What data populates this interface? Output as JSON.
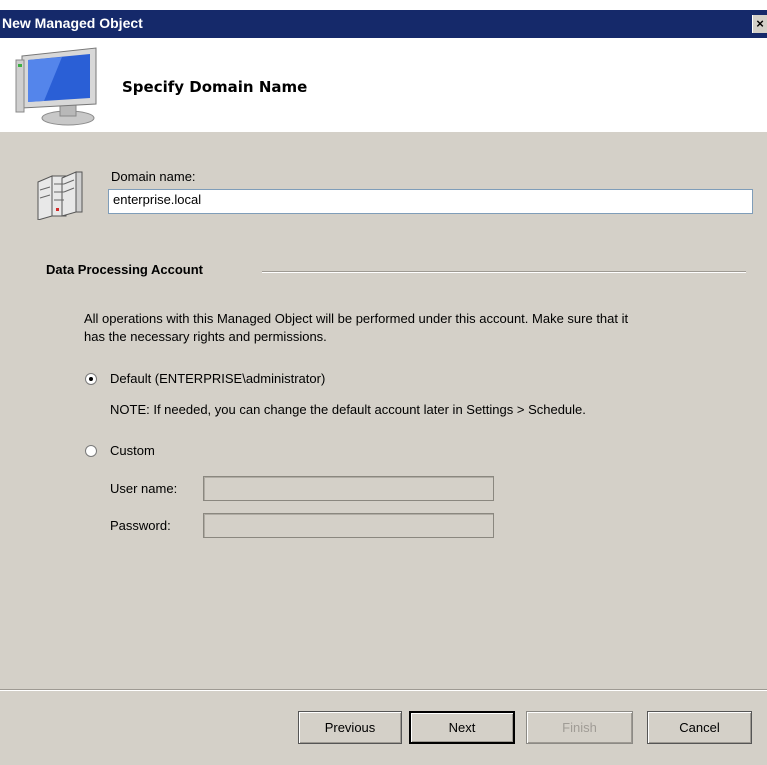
{
  "window": {
    "title": "New Managed Object",
    "close_glyph": "×"
  },
  "header": {
    "title": "Specify Domain Name",
    "icon": "monitor-icon"
  },
  "domain": {
    "label": "Domain name:",
    "value": "enterprise.local",
    "icon": "server-icon"
  },
  "account": {
    "group_title": "Data Processing Account",
    "description_line1": "All operations with this Managed Object will be performed under this account. Make sure that it",
    "description_line2": "has the necessary rights and permissions.",
    "default_label": "Default (ENTERPRISE\\administrator)",
    "default_selected": true,
    "note": "NOTE: If needed, you can change the default account later in Settings > Schedule.",
    "custom_label": "Custom",
    "custom_selected": false,
    "username_label": "User name:",
    "username_value": "",
    "password_label": "Password:",
    "password_value": ""
  },
  "buttons": {
    "previous": "Previous",
    "next": "Next",
    "finish": "Finish",
    "cancel": "Cancel"
  }
}
